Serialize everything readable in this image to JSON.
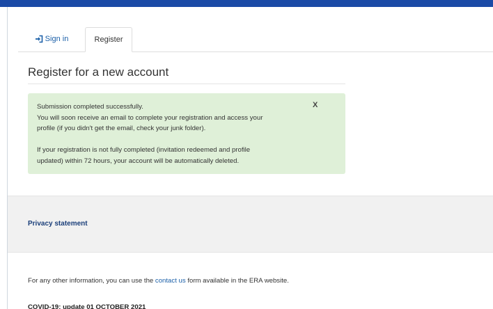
{
  "tabs": {
    "signin_label": "Sign in",
    "register_label": "Register"
  },
  "page": {
    "title": "Register for a new account"
  },
  "alert": {
    "line1": "Submission completed successfully.",
    "line2": "You will soon receive an email to complete your registration and access your",
    "line3": "profile (if you didn't get the email, check your junk folder).",
    "line4": "If your registration is not fully completed (invitation redeemed and profile",
    "line5": "updated) within 72 hours, your account will be automatically deleted.",
    "close_label": "X",
    "background_color": "#dff0d8"
  },
  "footer": {
    "privacy_label": "Privacy statement",
    "info_prefix": "For any other information, you can use the",
    "contact_label": "contact us",
    "info_suffix": "form available in the ERA website.",
    "covid_label": "COVID-19: update 01 OCTOBER 2021"
  },
  "icons": {
    "signin": "sign-in-icon"
  },
  "colors": {
    "top_bar": "#1b4aa6",
    "link": "#1a5fa8"
  }
}
